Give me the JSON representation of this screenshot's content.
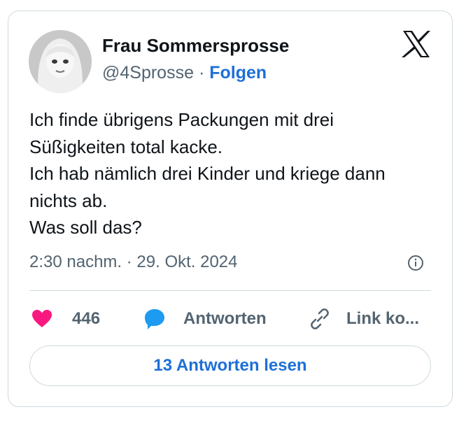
{
  "author": {
    "name": "Frau Sommersprosse",
    "handle": "@4Sprosse",
    "separator": "·",
    "follow_label": "Folgen"
  },
  "post": {
    "lines": [
      "Ich finde übrigens Packungen mit drei",
      "Süßigkeiten total kacke.",
      "Ich hab nämlich drei Kinder und kriege dann",
      "nichts ab.",
      "Was soll das?"
    ],
    "timestamp": "2:30 nachm. · 29. Okt. 2024"
  },
  "actions": {
    "like_count": "446",
    "reply_label": "Antworten",
    "copy_link_label": "Link ko..."
  },
  "read_replies_label": "13 Antworten lesen",
  "colors": {
    "accent": "#1d6fd8",
    "like": "#f91880",
    "reply": "#1d9bf0",
    "muted": "#536471",
    "border": "#cfd9de"
  },
  "icons": {
    "platform": "x-logo-icon",
    "info": "info-icon",
    "like": "heart-icon",
    "reply": "speech-bubble-icon",
    "link": "link-icon"
  }
}
